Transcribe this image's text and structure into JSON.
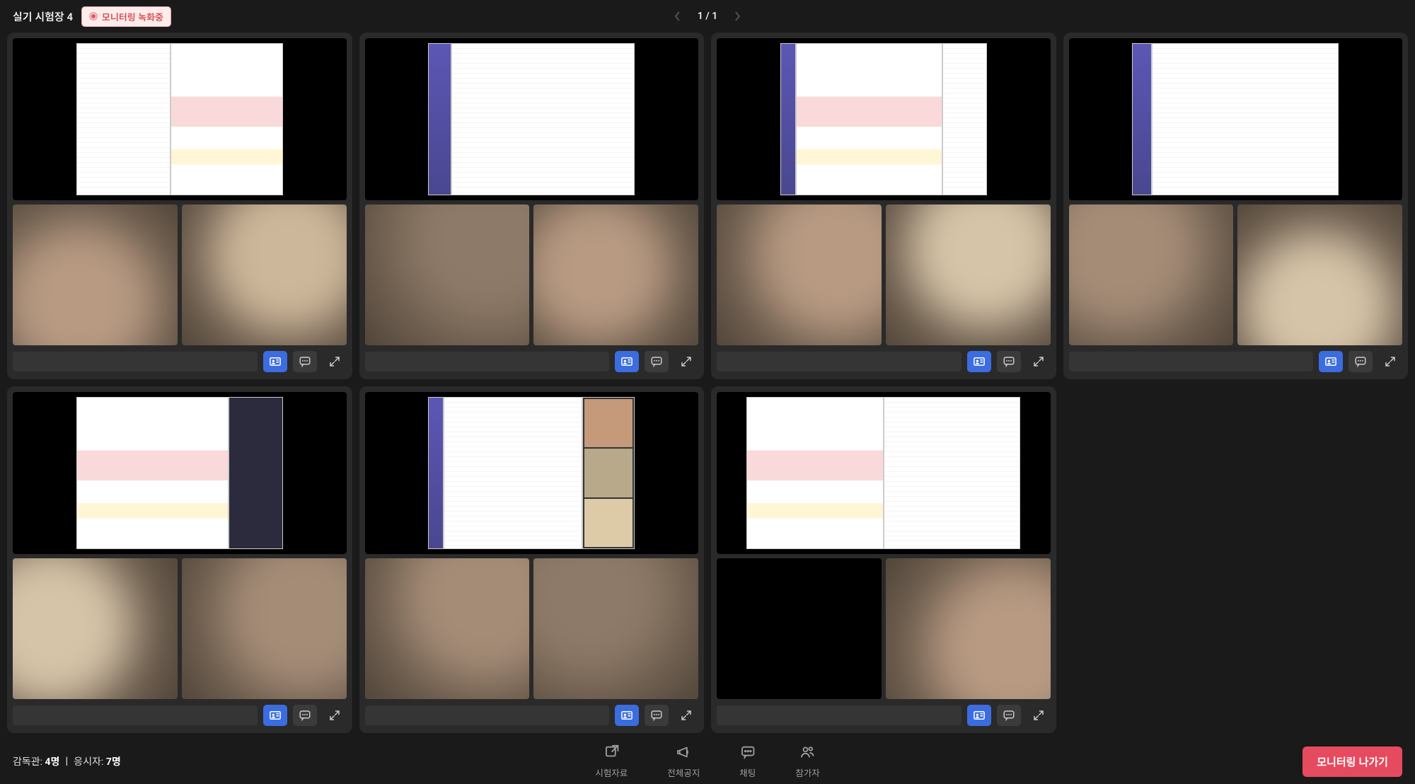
{
  "header": {
    "title": "실기 시험장 4",
    "recording_label": "모니터링 녹화중",
    "page_current": "1",
    "page_total": "1"
  },
  "footer": {
    "supervisor_label": "감독관:",
    "supervisor_count": "4명",
    "divider": "ㅣ",
    "examinee_label": "응시자:",
    "examinee_count": "7명",
    "tools": [
      {
        "id": "materials",
        "label": "시험자료",
        "icon": "external-link-icon"
      },
      {
        "id": "announce",
        "label": "전체공지",
        "icon": "megaphone-icon"
      },
      {
        "id": "chat",
        "label": "채팅",
        "icon": "chat-icon"
      },
      {
        "id": "participants",
        "label": "참가자",
        "icon": "people-icon"
      }
    ],
    "exit_label": "모니터링 나가기"
  },
  "card_actions": {
    "id_icon": "id-card-icon",
    "chat_icon": "chat-dots-icon",
    "full_icon": "expand-icon"
  },
  "participants": [
    {
      "cam1_black": false,
      "cam2_black": false
    },
    {
      "cam1_black": false,
      "cam2_black": false
    },
    {
      "cam1_black": false,
      "cam2_black": false
    },
    {
      "cam1_black": false,
      "cam2_black": false
    },
    {
      "cam1_black": false,
      "cam2_black": false
    },
    {
      "cam1_black": false,
      "cam2_black": false
    },
    {
      "cam1_black": true,
      "cam2_black": false
    }
  ],
  "colors": {
    "accent_blue": "#3b6de0",
    "accent_red": "#e64a5f",
    "badge_red": "#d84b4b",
    "bg": "#1a1a1a",
    "card_bg": "#2a2a2a"
  }
}
